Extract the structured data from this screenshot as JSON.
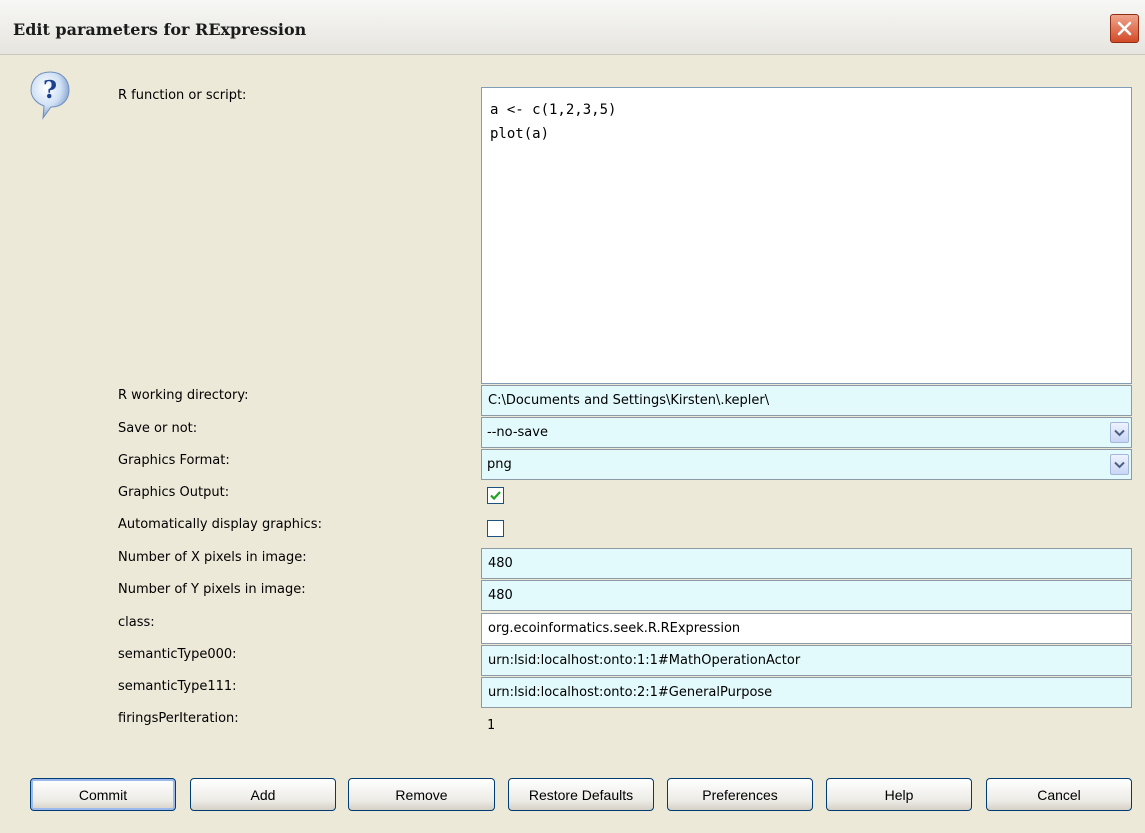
{
  "window": {
    "title": "Edit parameters for RExpression",
    "close_icon": "close-x-icon",
    "help_icon": "question-mark-bubble-icon"
  },
  "params": {
    "script": {
      "label": "R function or script:",
      "value": "a <- c(1,2,3,5)\nplot(a)"
    },
    "working_dir": {
      "label": "R working directory:",
      "value": "C:\\Documents and Settings\\Kirsten\\.kepler\\"
    },
    "save": {
      "label": "Save or not:",
      "value": "--no-save"
    },
    "graphics_format": {
      "label": "Graphics Format:",
      "value": "png"
    },
    "graphics_output": {
      "label": "Graphics Output:",
      "checked": true
    },
    "auto_display": {
      "label": "Automatically display graphics:",
      "checked": false
    },
    "x_pixels": {
      "label": "Number of X pixels in image:",
      "value": "480"
    },
    "y_pixels": {
      "label": "Number of Y pixels in image:",
      "value": "480"
    },
    "class": {
      "label": "class:",
      "value": "org.ecoinformatics.seek.R.RExpression"
    },
    "semantic0": {
      "label": "semanticType000:",
      "value": "urn:lsid:localhost:onto:1:1#MathOperationActor"
    },
    "semantic1": {
      "label": "semanticType111:",
      "value": "urn:lsid:localhost:onto:2:1#GeneralPurpose"
    },
    "firings": {
      "label": "firingsPerIteration:",
      "value": "1"
    }
  },
  "buttons": {
    "commit": "Commit",
    "add": "Add",
    "remove": "Remove",
    "restore": "Restore Defaults",
    "preferences": "Preferences",
    "help": "Help",
    "cancel": "Cancel"
  },
  "colors": {
    "dialog_bg": "#ece9d8",
    "field_bg": "#e2fafc",
    "close_red": "#d24a28",
    "checkbox_check": "#21a121"
  }
}
